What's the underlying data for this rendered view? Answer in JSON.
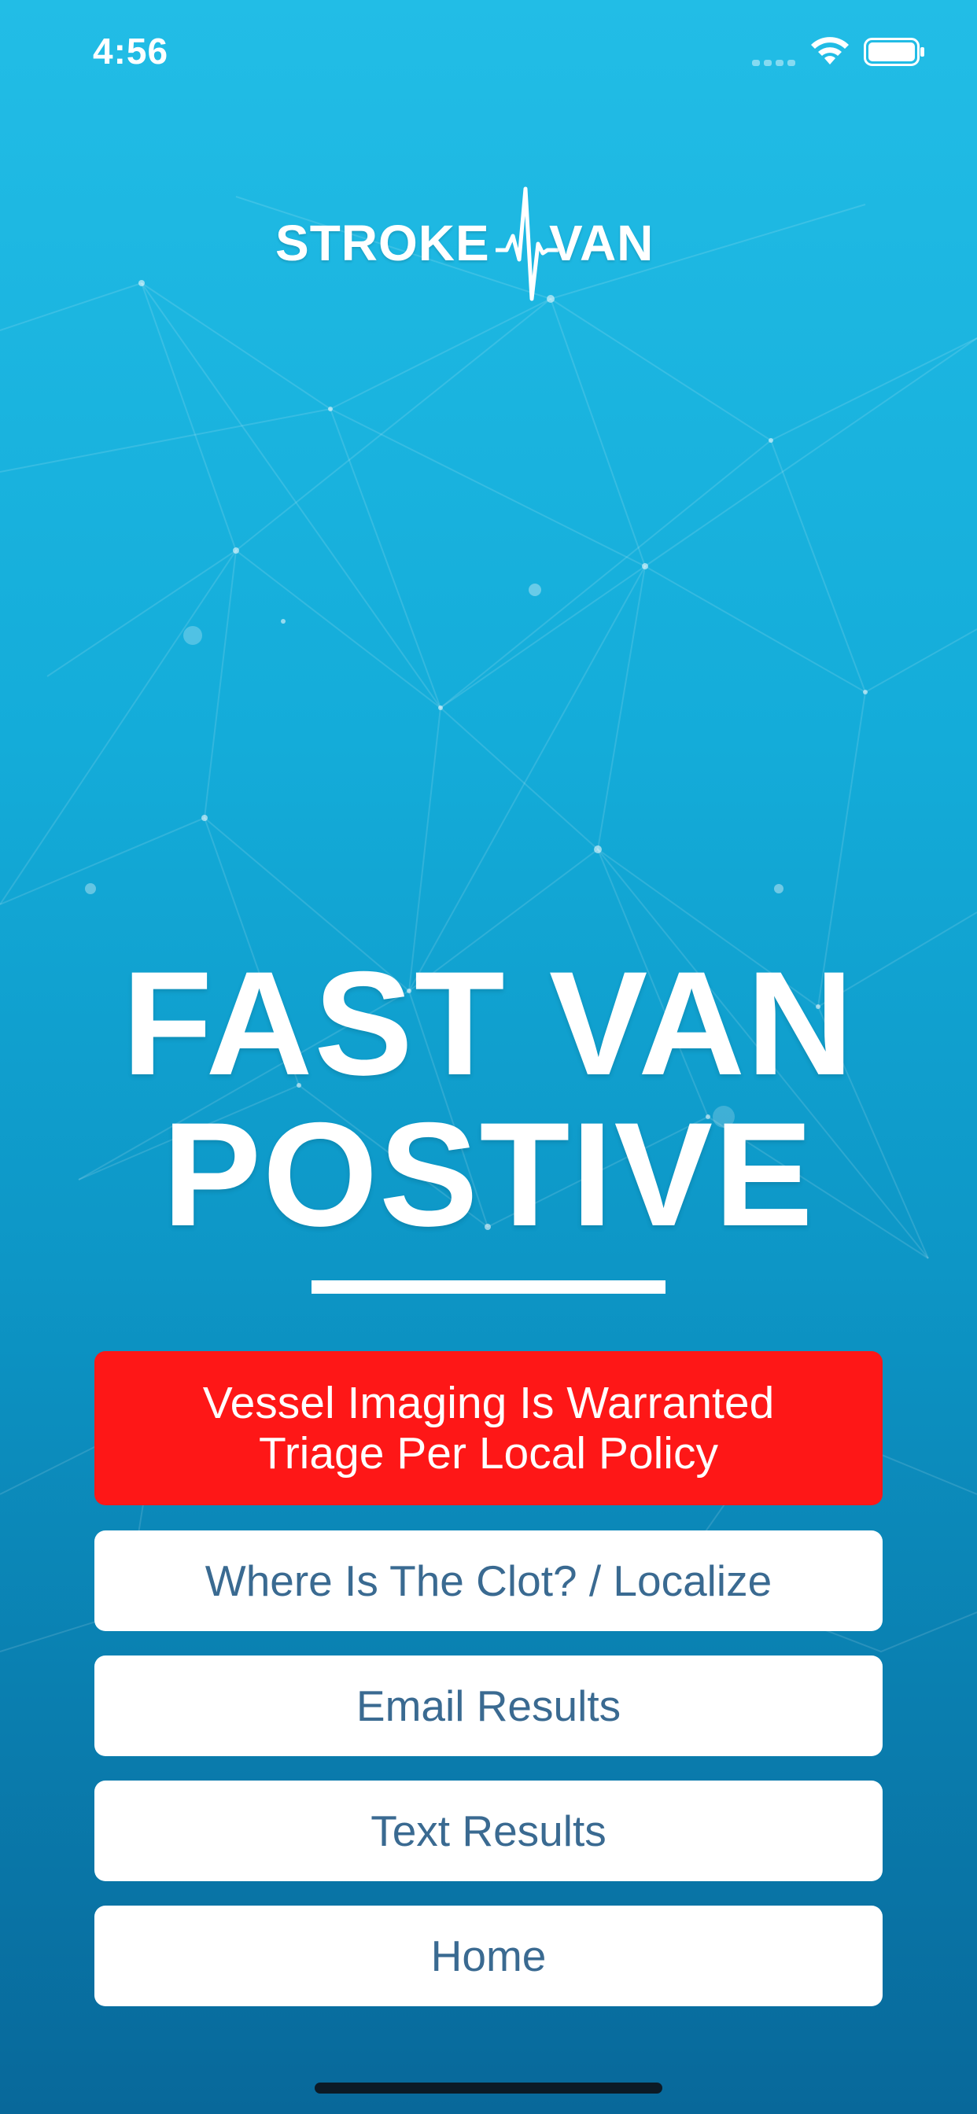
{
  "status_bar": {
    "time": "4:56"
  },
  "logo": {
    "left_text": "STROKE",
    "right_text": "VAN"
  },
  "headline": {
    "line1": "FAST VAN",
    "line2": "POSTIVE"
  },
  "alert_box": {
    "line1": "Vessel Imaging Is Warranted",
    "line2": "Triage Per Local Policy"
  },
  "buttons": {
    "localize": "Where Is The Clot? / Localize",
    "email": "Email Results",
    "text": "Text Results",
    "home": "Home"
  },
  "colors": {
    "alert": "#fe1717",
    "button_text": "#3a6a91",
    "background_top": "#22bde6",
    "background_bottom": "#08689a"
  }
}
